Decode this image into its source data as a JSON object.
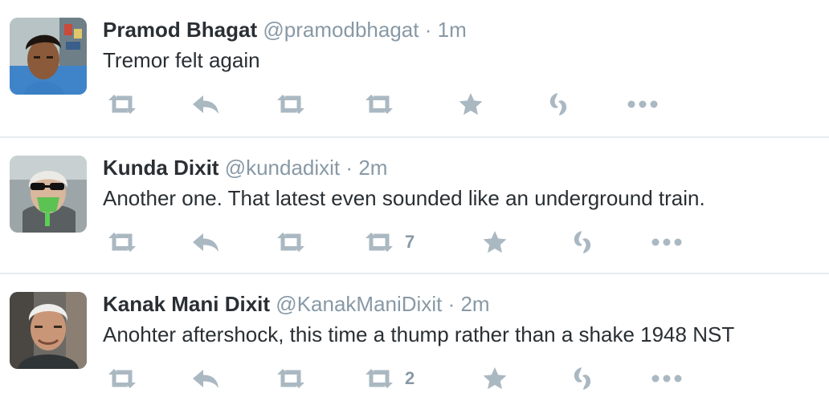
{
  "tweets": [
    {
      "name": "Pramod Bhagat",
      "handle": "@pramodbhagat",
      "separator": "·",
      "time": "1m",
      "text": "Tremor felt again",
      "retweet_count": "",
      "avatar_icon": "profile-photo"
    },
    {
      "name": "Kunda Dixit",
      "handle": "@kundadixit",
      "separator": "·",
      "time": "2m",
      "text": "Another one. That latest even sounded like an underground train.",
      "retweet_count": "7",
      "avatar_icon": "profile-photo"
    },
    {
      "name": "Kanak Mani Dixit",
      "handle": "@KanakManiDixit",
      "separator": "·",
      "time": "2m",
      "text": "Anohter aftershock, this time a thump rather than a shake 1948 NST",
      "retweet_count": "2",
      "avatar_icon": "profile-photo"
    }
  ],
  "action_icons": [
    "retweet-icon",
    "reply-icon",
    "retweet-icon",
    "retweet-icon",
    "favorite-star-icon",
    "s-logo-icon",
    "more-dots-icon"
  ],
  "colors": {
    "name": "#292f33",
    "meta": "#8899a6",
    "icon": "#aab8c2",
    "divider": "#e6ecf0"
  }
}
